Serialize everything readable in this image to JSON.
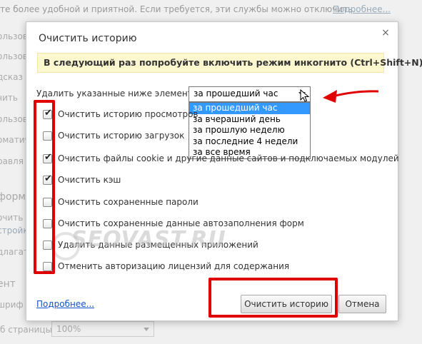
{
  "background": {
    "top_text": "те более удобной и приятной. Если требуется, эти службы можно отключить.",
    "top_link": "Подробнее...",
    "left_fragments": [
      "ользов",
      "ользов",
      "дсказ",
      "чить",
      "ользов",
      "оматич",
      "равля",
      "форм",
      "очить",
      "стройк",
      "длагат",
      "ент",
      "шриф"
    ],
    "zoom_label": "б страницы:",
    "zoom_value": "100%"
  },
  "dialog": {
    "title": "Очистить историю",
    "close_symbol": "×",
    "incognito_banner": "В следующий раз попробуйте включить режим инкогнито (Ctrl+Shift+N).",
    "period_label": "Удалить указанные ниже элементы:",
    "period_selected": "за прошедший час",
    "period_options": [
      "за прошедший час",
      "за вчерашний день",
      "за прошлую неделю",
      "за последние 4 недели",
      "за все время"
    ],
    "items": [
      {
        "label": "Очистить историю просмотров",
        "checked": true,
        "check": "✔"
      },
      {
        "label": "Очистить историю загрузок",
        "checked": false,
        "check": ""
      },
      {
        "label": "Очистить файлы cookie и другие данные сайтов и подключаемых модулей",
        "checked": true,
        "check": "✔"
      },
      {
        "label": "Очистить кэш",
        "checked": true,
        "check": "✔"
      },
      {
        "label": "Очистить сохраненные пароли",
        "checked": false,
        "check": ""
      },
      {
        "label": "Очистить сохраненные данные автозаполнения форм",
        "checked": false,
        "check": ""
      },
      {
        "label": "Удалить данные размещенных приложений",
        "checked": false,
        "check": ""
      },
      {
        "label": "Отменить авторизацию лицензий для содержания",
        "checked": false,
        "check": ""
      }
    ],
    "more_link": "Подробнее...",
    "clear_button": "Очистить историю",
    "cancel_button": "Отмена"
  },
  "watermark": "SEOVAST.RU",
  "colors": {
    "highlight": "#e00000",
    "banner_bg": "#fdf7cf",
    "selected_option": "#3399ff",
    "link": "#1155cc"
  }
}
